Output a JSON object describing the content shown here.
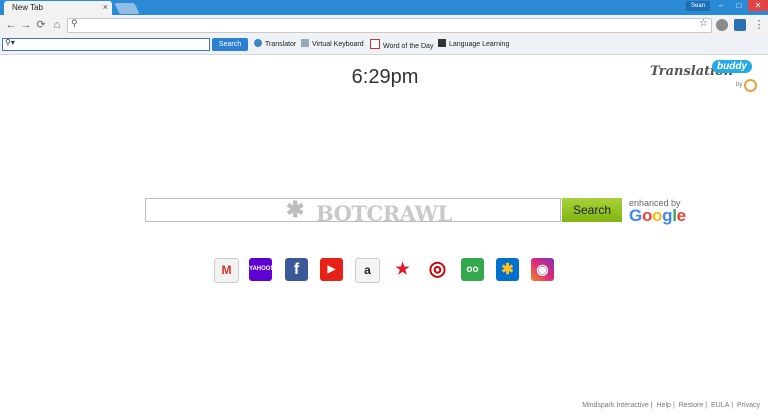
{
  "browser": {
    "tab_title": "New Tab",
    "user": "Sean",
    "tab_close": "×",
    "window_controls": {
      "minimize": "–",
      "maximize": "□",
      "close": "✕"
    },
    "icons": [
      "back-icon",
      "forward-icon",
      "reload-icon",
      "home-icon",
      "search-icon",
      "star-icon",
      "menu-icon"
    ]
  },
  "toolbar": {
    "search_placeholder": "",
    "search_button": "Search",
    "items": [
      {
        "label": "Translator",
        "icon": "translator-icon"
      },
      {
        "label": "Virtual Keyboard",
        "icon": "keyboard-icon"
      },
      {
        "label": "Word of the Day",
        "icon": "calendar-icon"
      },
      {
        "label": "Language Learning",
        "icon": "graduation-cap-icon"
      }
    ]
  },
  "main": {
    "clock": "6:29pm",
    "brand": {
      "word1": "Translation",
      "word2": "buddy",
      "by": "by"
    },
    "watermark": "BOTCRAWL",
    "search_button": "Search",
    "enhanced_by": "enhanced by",
    "google": "Google",
    "quick_links": [
      {
        "name": "gmail",
        "glyph": "M",
        "bg": "#f2f2f2",
        "fg": "#d93025"
      },
      {
        "name": "yahoo",
        "glyph": "YAHOO!",
        "bg": "#5f01d1",
        "fg": "#ffffff"
      },
      {
        "name": "facebook",
        "glyph": "f",
        "bg": "#3b5998",
        "fg": "#ffffff"
      },
      {
        "name": "youtube",
        "glyph": "▶",
        "bg": "#e62117",
        "fg": "#ffffff"
      },
      {
        "name": "amazon",
        "glyph": "a",
        "bg": "#f4f4f4",
        "fg": "#222222"
      },
      {
        "name": "macys",
        "glyph": "★",
        "bg": "#ffffff",
        "fg": "#e21a2c"
      },
      {
        "name": "target",
        "glyph": "◎",
        "bg": "#ffffff",
        "fg": "#cc0000"
      },
      {
        "name": "tripadvisor",
        "glyph": "oo",
        "bg": "#34a84d",
        "fg": "#ffffff"
      },
      {
        "name": "walmart",
        "glyph": "✱",
        "bg": "#0071ce",
        "fg": "#ffc220"
      },
      {
        "name": "instagram",
        "glyph": "◉",
        "bg": "#c13584",
        "fg": "#ffffff"
      }
    ]
  },
  "footer": {
    "links": [
      "Mindspark Interactive",
      "Help",
      "Restore",
      "EULA",
      "Privacy"
    ]
  },
  "colors": {
    "titlebar": "#2b8ad6",
    "search_green": "#8dc21f",
    "toolbar_button": "#2d7fd2"
  }
}
